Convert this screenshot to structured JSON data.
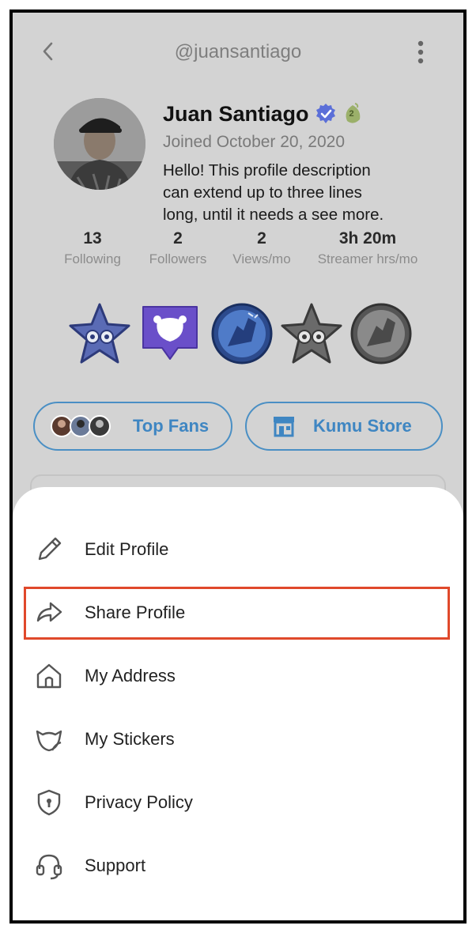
{
  "header": {
    "handle": "@juansantiago"
  },
  "profile": {
    "name": "Juan Santiago",
    "verified_badge_level": "2",
    "joined": "Joined October 20, 2020",
    "bio_lines": [
      "Hello! This profile description",
      "can extend up to three lines",
      "long, until it needs a see more."
    ],
    "stats": [
      {
        "value": "13",
        "label": "Following"
      },
      {
        "value": "2",
        "label": "Followers"
      },
      {
        "value": "2",
        "label": "Views/mo"
      },
      {
        "value": "3h 20m",
        "label": "Streamer hrs/mo"
      }
    ]
  },
  "actions": {
    "top_fans_label": "Top Fans",
    "store_label": "Kumu Store"
  },
  "menu": {
    "items": [
      {
        "label": "Edit Profile",
        "icon": "pencil-icon"
      },
      {
        "label": "Share Profile",
        "icon": "share-arrow-icon"
      },
      {
        "label": "My Address",
        "icon": "home-icon"
      },
      {
        "label": "My Stickers",
        "icon": "sticker-icon"
      },
      {
        "label": "Privacy Policy",
        "icon": "shield-lock-icon"
      },
      {
        "label": "Support",
        "icon": "headset-icon"
      }
    ],
    "highlighted_index": 1
  },
  "colors": {
    "accent": "#3f86c2",
    "highlight": "#e0492b",
    "overlay": "#d3d3d3",
    "verified": "#5b6fd8",
    "badge_purple": "#6a4fc9"
  }
}
